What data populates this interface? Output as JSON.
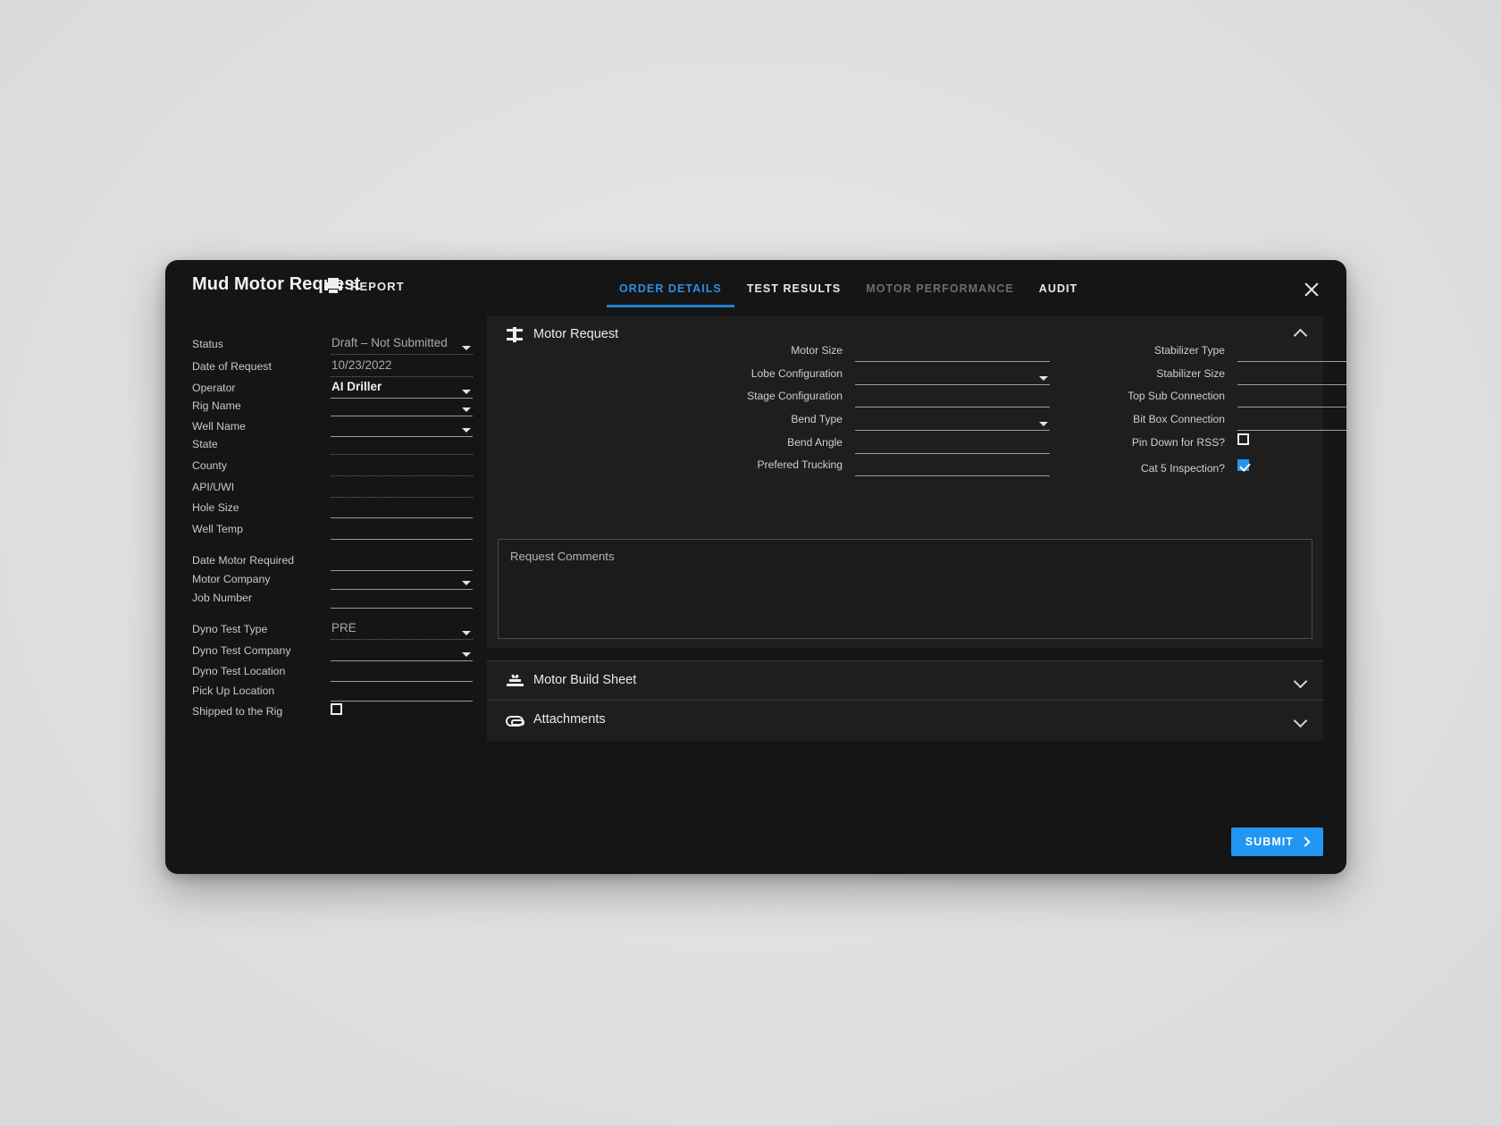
{
  "header": {
    "title": "Mud Motor Request",
    "report_label": "REPORT",
    "report_icon": "printer-icon",
    "close_icon": "close-icon",
    "tabs": [
      {
        "label": "ORDER DETAILS",
        "state": "active"
      },
      {
        "label": "TEST RESULTS",
        "state": "normal"
      },
      {
        "label": "MOTOR PERFORMANCE",
        "state": "disabled"
      },
      {
        "label": "AUDIT",
        "state": "normal"
      }
    ]
  },
  "sidebar": {
    "fields": [
      {
        "label": "Status",
        "value": "Draft – Not Submitted",
        "type": "select",
        "underline": "dotted",
        "emphasis": "normal"
      },
      {
        "label": "Date of Request",
        "value": "10/23/2022",
        "type": "text",
        "underline": "dotted",
        "emphasis": "normal"
      },
      {
        "label": "Operator",
        "value": "AI Driller",
        "type": "select",
        "underline": "solid",
        "emphasis": "strong"
      },
      {
        "label": "Rig Name",
        "value": "",
        "type": "select",
        "underline": "solid",
        "emphasis": "normal"
      },
      {
        "label": "Well Name",
        "value": "",
        "type": "select",
        "underline": "solid",
        "emphasis": "normal"
      },
      {
        "label": "State",
        "value": "",
        "type": "text",
        "underline": "dotted",
        "emphasis": "normal"
      },
      {
        "label": "County",
        "value": "",
        "type": "text",
        "underline": "dotted",
        "emphasis": "normal"
      },
      {
        "label": "API/UWI",
        "value": "",
        "type": "text",
        "underline": "dotted",
        "emphasis": "normal"
      },
      {
        "label": "Hole Size",
        "value": "",
        "type": "text",
        "underline": "solid",
        "emphasis": "normal"
      },
      {
        "label": "Well Temp",
        "value": "",
        "type": "text",
        "underline": "solid",
        "emphasis": "normal"
      },
      {
        "label": "Date Motor Required",
        "value": "",
        "type": "text",
        "underline": "solid",
        "emphasis": "normal"
      },
      {
        "label": "Motor Company",
        "value": "",
        "type": "select",
        "underline": "solid",
        "emphasis": "normal"
      },
      {
        "label": "Job Number",
        "value": "",
        "type": "text",
        "underline": "solid",
        "emphasis": "normal"
      },
      {
        "label": "Dyno Test Type",
        "value": "PRE",
        "type": "select",
        "underline": "dotted",
        "emphasis": "normal"
      },
      {
        "label": "Dyno Test Company",
        "value": "",
        "type": "select",
        "underline": "solid",
        "emphasis": "normal"
      },
      {
        "label": "Dyno Test Location",
        "value": "",
        "type": "text",
        "underline": "solid",
        "emphasis": "normal"
      },
      {
        "label": "Pick Up Location",
        "value": "",
        "type": "text",
        "underline": "solid",
        "emphasis": "normal"
      },
      {
        "label": "Shipped to the Rig",
        "value": "",
        "type": "checkbox",
        "checked": false
      }
    ]
  },
  "main": {
    "motor_request": {
      "title": "Motor Request",
      "icon": "motor-icon",
      "expanded": true,
      "chevron_icon": "chevron-up-icon",
      "left_fields": [
        {
          "label": "Motor Size",
          "value": "",
          "type": "text"
        },
        {
          "label": "Lobe Configuration",
          "value": "",
          "type": "select"
        },
        {
          "label": "Stage Configuration",
          "value": "",
          "type": "text"
        },
        {
          "label": "Bend Type",
          "value": "",
          "type": "select"
        },
        {
          "label": "Bend Angle",
          "value": "",
          "type": "text"
        },
        {
          "label": "Prefered Trucking",
          "value": "",
          "type": "text"
        }
      ],
      "right_fields": [
        {
          "label": "Stabilizer Type",
          "value": "",
          "type": "select"
        },
        {
          "label": "Stabilizer Size",
          "value": "",
          "type": "text"
        },
        {
          "label": "Top Sub Connection",
          "value": "",
          "type": "select"
        },
        {
          "label": "Bit Box Connection",
          "value": "",
          "type": "select"
        },
        {
          "label": "Pin Down for RSS?",
          "value": "",
          "type": "checkbox",
          "checked": false
        },
        {
          "label": "Cat 5 Inspection?",
          "value": "",
          "type": "checkbox",
          "checked": true
        }
      ],
      "comments_placeholder": "Request Comments"
    },
    "sections": [
      {
        "title": "Motor Build Sheet",
        "icon": "motor-build-sheet-icon",
        "expanded": false,
        "chevron_icon": "chevron-down-icon"
      },
      {
        "title": "Attachments",
        "icon": "paperclip-icon",
        "expanded": false,
        "chevron_icon": "chevron-down-icon"
      }
    ]
  },
  "footer": {
    "submit_label": "SUBMIT",
    "submit_icon": "chevron-right-icon"
  },
  "colors": {
    "accent": "#2196f3",
    "active_tab": "#2e8fe0",
    "dialog_bg": "#151515",
    "panel_bg": "#1e1e1e",
    "page_bg": "#e3e4e6"
  }
}
